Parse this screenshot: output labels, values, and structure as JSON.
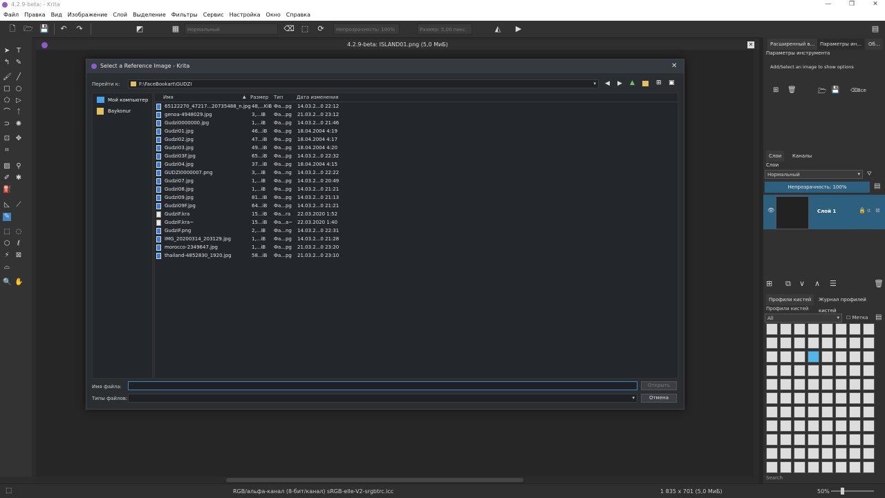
{
  "window": {
    "title": "4.2.9-beta:  - Krita",
    "min": "—",
    "max": "❐",
    "close": "✕"
  },
  "menu": [
    "Файл",
    "Правка",
    "Вид",
    "Изображение",
    "Слой",
    "Выделение",
    "Фильтры",
    "Сервис",
    "Настройка",
    "Окно",
    "Справка"
  ],
  "toolbar": {
    "blend_mode": "Нормальный",
    "opacity": "Непрозрачность: 100%",
    "size": "Размер: 5,00 пикс."
  },
  "document": {
    "title": "4.2.9-beta: ISLAND01.png (5,0 МиБ)"
  },
  "dialog": {
    "title": "Select a Reference Image - Krita",
    "goto_label": "Перейти к:",
    "path": "F:\\FaceBookart\\GUDZI",
    "places": [
      {
        "label": "Мой компьютер",
        "icon": "computer-icon"
      },
      {
        "label": "Baykonur",
        "icon": "user-folder-icon"
      }
    ],
    "columns": {
      "name": "Имя",
      "size": "Размер",
      "type": "Тип",
      "date": "Дата изменения"
    },
    "files": [
      {
        "name": "65122270_47217...20735488_n.jpg",
        "size": "48,...KiB",
        "type": "Фа...pg",
        "date": "14.03.2...0 22:12",
        "kind": "img"
      },
      {
        "name": "genoa-4948029.jpg",
        "size": "3,...iB",
        "type": "Фа...pg",
        "date": "21.03.2...0 23:12",
        "kind": "img"
      },
      {
        "name": "Gudzi0000000.jpg",
        "size": "1,...iB",
        "type": "Фа...pg",
        "date": "14.03.2...0 21:46",
        "kind": "img"
      },
      {
        "name": "Gudzi01.jpg",
        "size": "46...iB",
        "type": "Фа...pg",
        "date": "18.04.2004 4:19",
        "kind": "img"
      },
      {
        "name": "Gudzi02.jpg",
        "size": "47...iB",
        "type": "Фа...pg",
        "date": "18.04.2004 4:17",
        "kind": "img"
      },
      {
        "name": "Gudzi03.jpg",
        "size": "49...iB",
        "type": "Фа...pg",
        "date": "18.04.2004 4:20",
        "kind": "img"
      },
      {
        "name": "Gudzi03F.jpg",
        "size": "65...iB",
        "type": "Фа...pg",
        "date": "14.03.2...0 22:32",
        "kind": "img"
      },
      {
        "name": "Gudzi04.jpg",
        "size": "37...iB",
        "type": "Фа...pg",
        "date": "18.04.2004 4:15",
        "kind": "img"
      },
      {
        "name": "GUDZI0000007.png",
        "size": "3,...iB",
        "type": "Фа...ng",
        "date": "14.03.2...0 22:22",
        "kind": "img"
      },
      {
        "name": "Gudzi07.jpg",
        "size": "1,...iB",
        "type": "Фа...pg",
        "date": "14.03.2...0 20:49",
        "kind": "img"
      },
      {
        "name": "Gudzi08.jpg",
        "size": "1,...iB",
        "type": "Фа...pg",
        "date": "14.03.2...0 21:21",
        "kind": "img"
      },
      {
        "name": "Gudzi09.jpg",
        "size": "81...iB",
        "type": "Фа...pg",
        "date": "14.03.2...0 21:13",
        "kind": "img"
      },
      {
        "name": "Gudzi09F.jpg",
        "size": "64...iB",
        "type": "Фа...pg",
        "date": "14.03.2...0 21:21",
        "kind": "img"
      },
      {
        "name": "GudziF.kra",
        "size": "15...iB",
        "type": "Фа...ra",
        "date": "22.03.2020 1:52",
        "kind": "kra"
      },
      {
        "name": "GudziF.kra~",
        "size": "15...iB",
        "type": "Фа...a~",
        "date": "22.03.2020 1:40",
        "kind": "kra"
      },
      {
        "name": "GudziF.png",
        "size": "2,...iB",
        "type": "Фа...ng",
        "date": "14.03.2...0 22:31",
        "kind": "img"
      },
      {
        "name": "IMG_20200314_203129.jpg",
        "size": "1,...iB",
        "type": "Фа...pg",
        "date": "14.03.2...0 21:28",
        "kind": "img"
      },
      {
        "name": "morocco-2349647.jpg",
        "size": "1,...iB",
        "type": "Фа...pg",
        "date": "21.03.2...0 23:20",
        "kind": "img"
      },
      {
        "name": "thailand-4852830_1920.jpg",
        "size": "58...iB",
        "type": "Фа...pg",
        "date": "21.03.2...0 23:10",
        "kind": "img"
      }
    ],
    "filename_label": "Имя файла:",
    "filename_value": "",
    "filetypes_label": "Типы файлов:",
    "filetypes_value": "",
    "open_button": "Открыть",
    "cancel_button": "Отмена"
  },
  "right_panel": {
    "tabs_top": [
      "Расширенный в...",
      "Параметры ин...",
      "Об..."
    ],
    "tool_options_title": "Параметры инструмента",
    "tool_options_hint": "Add/Select an image to show options",
    "delete_all_label": "Все",
    "layer_tabs": [
      "Слои",
      "Каналы"
    ],
    "layers_title": "Слои",
    "layer_blend": "Нормальный",
    "layer_opacity": "Непрозрачность:  100%",
    "layer_name": "Слой 1",
    "brush_tabs": [
      "Профили кистей",
      "Журнал профилей кистей"
    ],
    "brush_title": "Профили кистей",
    "brush_filter": "All",
    "brush_tag_label": "Метка",
    "search_placeholder": "Search"
  },
  "status": {
    "color_profile": "RGB/альфа-канал (8-бит/канал)  sRGB-elle-V2-srgbtrc.icc",
    "dimensions": "1 835 x 701 (5,0 МиБ)",
    "zoom": "50%"
  },
  "colors": {
    "accent": "#2d5f7e",
    "selection": "#3a6fa8",
    "krita": "#8a5cc6"
  }
}
